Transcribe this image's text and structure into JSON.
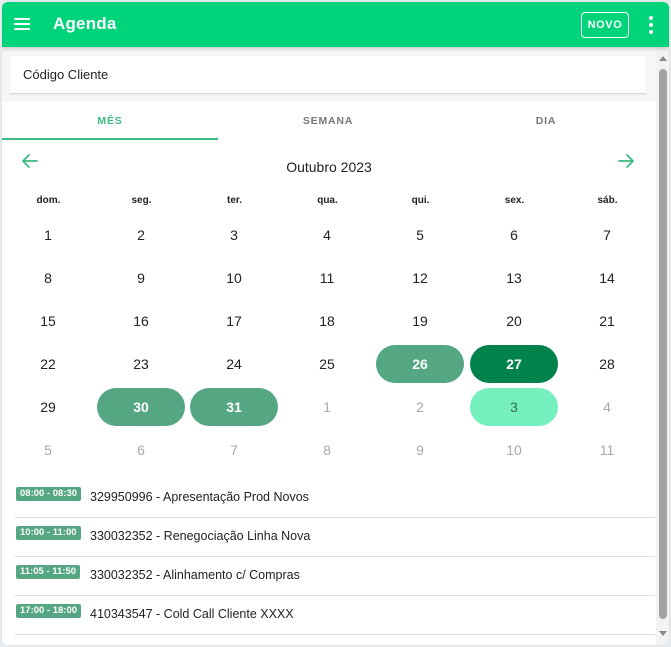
{
  "header": {
    "title": "Agenda",
    "new_label": "NOVO"
  },
  "search": {
    "placeholder": "Código Cliente",
    "value": ""
  },
  "tabs": [
    "MÊS",
    "SEMANA",
    "DIA"
  ],
  "calendar": {
    "title": "Outubro 2023",
    "weekdays": [
      "dom.",
      "seg.",
      "ter.",
      "qua.",
      "qui.",
      "sex.",
      "sáb."
    ],
    "weeks": [
      [
        {
          "d": "1",
          "s": ""
        },
        {
          "d": "2",
          "s": ""
        },
        {
          "d": "3",
          "s": ""
        },
        {
          "d": "4",
          "s": ""
        },
        {
          "d": "5",
          "s": ""
        },
        {
          "d": "6",
          "s": ""
        },
        {
          "d": "7",
          "s": ""
        }
      ],
      [
        {
          "d": "8",
          "s": ""
        },
        {
          "d": "9",
          "s": ""
        },
        {
          "d": "10",
          "s": ""
        },
        {
          "d": "11",
          "s": ""
        },
        {
          "d": "12",
          "s": ""
        },
        {
          "d": "13",
          "s": ""
        },
        {
          "d": "14",
          "s": ""
        }
      ],
      [
        {
          "d": "15",
          "s": ""
        },
        {
          "d": "16",
          "s": ""
        },
        {
          "d": "17",
          "s": ""
        },
        {
          "d": "18",
          "s": ""
        },
        {
          "d": "19",
          "s": ""
        },
        {
          "d": "20",
          "s": ""
        },
        {
          "d": "21",
          "s": ""
        }
      ],
      [
        {
          "d": "22",
          "s": ""
        },
        {
          "d": "23",
          "s": ""
        },
        {
          "d": "24",
          "s": ""
        },
        {
          "d": "25",
          "s": ""
        },
        {
          "d": "26",
          "s": "sel"
        },
        {
          "d": "27",
          "s": "today"
        },
        {
          "d": "28",
          "s": ""
        }
      ],
      [
        {
          "d": "29",
          "s": ""
        },
        {
          "d": "30",
          "s": "sel"
        },
        {
          "d": "31",
          "s": "sel"
        },
        {
          "d": "1",
          "s": "muted"
        },
        {
          "d": "2",
          "s": "muted"
        },
        {
          "d": "3",
          "s": "next"
        },
        {
          "d": "4",
          "s": "muted"
        }
      ],
      [
        {
          "d": "5",
          "s": "muted"
        },
        {
          "d": "6",
          "s": "muted"
        },
        {
          "d": "7",
          "s": "muted"
        },
        {
          "d": "8",
          "s": "muted"
        },
        {
          "d": "9",
          "s": "muted"
        },
        {
          "d": "10",
          "s": "muted"
        },
        {
          "d": "11",
          "s": "muted"
        }
      ]
    ]
  },
  "events": [
    {
      "time": "08:00 - 08:30",
      "title": "329950996 - Apresentação Prod Novos"
    },
    {
      "time": "10:00 - 11:00",
      "title": "330032352 - Renegociação Linha Nova"
    },
    {
      "time": "11:05 - 11:50",
      "title": "330032352 - Alinhamento c/ Compras"
    },
    {
      "time": "17:00 - 18:00",
      "title": "410343547 - Cold Call Cliente XXXX"
    }
  ],
  "colors": {
    "brand": "#00d47a",
    "selected_day": "#55a683",
    "today": "#00834a",
    "next_month_highlight": "#74efbd"
  }
}
